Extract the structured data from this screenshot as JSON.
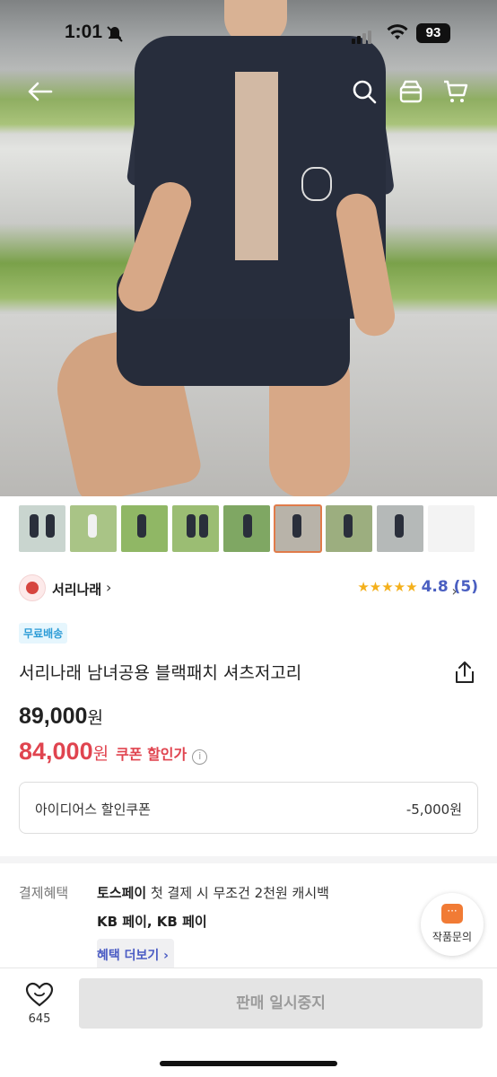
{
  "status_bar": {
    "time": "1:01",
    "battery": "93"
  },
  "thumbnails": [
    {
      "bg": "#c9d5cf"
    },
    {
      "bg": "#a9c486"
    },
    {
      "bg": "#90b765"
    },
    {
      "bg": "#9bbd73"
    },
    {
      "bg": "#7fa763"
    },
    {
      "bg": "#b8b3a9"
    },
    {
      "bg": "#9cae7f"
    },
    {
      "bg": "#b5b9b8"
    },
    {
      "bg": "#f3f3f3"
    }
  ],
  "seller": {
    "name": "서리나래",
    "chevron": "›"
  },
  "rating": {
    "stars": "★★★★★",
    "score": "4.8 (5)",
    "chevron": "›"
  },
  "badges": {
    "free_shipping": "무료배송"
  },
  "product": {
    "title": "서리나래 남녀공용 블랙패치 셔츠저고리",
    "original_price": "89,000",
    "sale_price": "84,000",
    "currency": "원",
    "coupon_label": "쿠폰 할인가",
    "info_icon": "i"
  },
  "coupon": {
    "label": "아이디어스 할인쿠폰",
    "amount": "-5,000원"
  },
  "benefits": {
    "label": "결제혜택",
    "line1_bold": "토스페이",
    "line1_rest": " 첫 결제 시 무조건 2천원 캐시백",
    "line2": "KB 페이, KB 페이",
    "more": "혜택 더보기 ›"
  },
  "inquiry": {
    "label": "작품문의",
    "icon_text": "···"
  },
  "bottom": {
    "like_count": "645",
    "sold_out_label": "판매 일시중지"
  },
  "colors": {
    "accent_red": "#e0444f",
    "accent_blue": "#4a5fc1",
    "star": "#f4b01b",
    "inquiry_orange": "#f17b35"
  }
}
